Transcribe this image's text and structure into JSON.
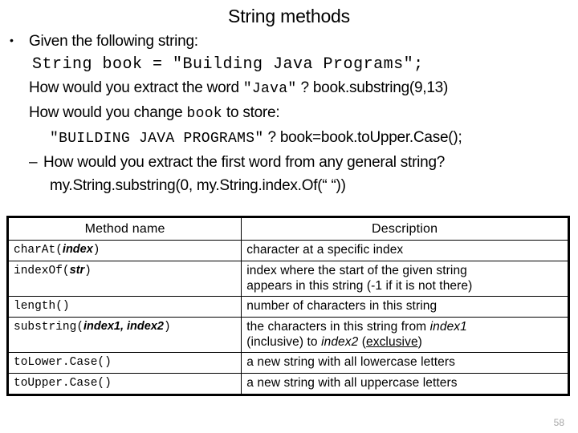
{
  "slide": {
    "title": "String methods",
    "page_number": "58",
    "bullets": {
      "b1_marker": "•",
      "b1_text": "Given the following string:",
      "code1": "String book = \"Building Java Programs\";",
      "q1_pre": "How would you extract the word ",
      "q1_code": "\"Java\"",
      "q1_post": " ? book.substring(9,13)",
      "q2_pre": "How would you change ",
      "q2_code": "book",
      "q2_post": " to store:",
      "q2b_code": "\"BUILDING JAVA PROGRAMS\"",
      "q2b_post": " ?  book=book.toUpper.Case();",
      "b3_marker": "–",
      "b3_text": "How would you extract the first word from any general string?",
      "b4_text": "my.String.substring(0, my.String.index.Of(“ “))"
    }
  },
  "table": {
    "headers": [
      "Method name",
      "Description"
    ],
    "rows": [
      {
        "method_pre": "charAt(",
        "method_arg": "index",
        "method_post": ")",
        "desc": "character at a specific index"
      },
      {
        "method_pre": "indexOf(",
        "method_arg": "str",
        "method_post": ")",
        "desc_line1": "index where the start of the given string",
        "desc_line2": "appears in this string (-1 if it is not there)"
      },
      {
        "method_pre": "length()",
        "method_arg": "",
        "method_post": "",
        "desc": "number of characters in this string"
      },
      {
        "method_pre": "substring(",
        "method_arg": "index1,  index2",
        "method_post": ")",
        "desc_a": "the characters in this string from ",
        "desc_a_ital": "index1",
        "desc_b": "(inclusive) to ",
        "desc_b_ital": "index2",
        "desc_b_paren_open": " (",
        "desc_b_uline": "exclusive",
        "desc_b_paren_close": ")"
      },
      {
        "method_pre": "toLower.Case()",
        "method_arg": "",
        "method_post": "",
        "desc": "a new string with all lowercase letters"
      },
      {
        "method_pre": "toUpper.Case()",
        "method_arg": "",
        "method_post": "",
        "desc": "a new string with all uppercase letters"
      }
    ]
  }
}
